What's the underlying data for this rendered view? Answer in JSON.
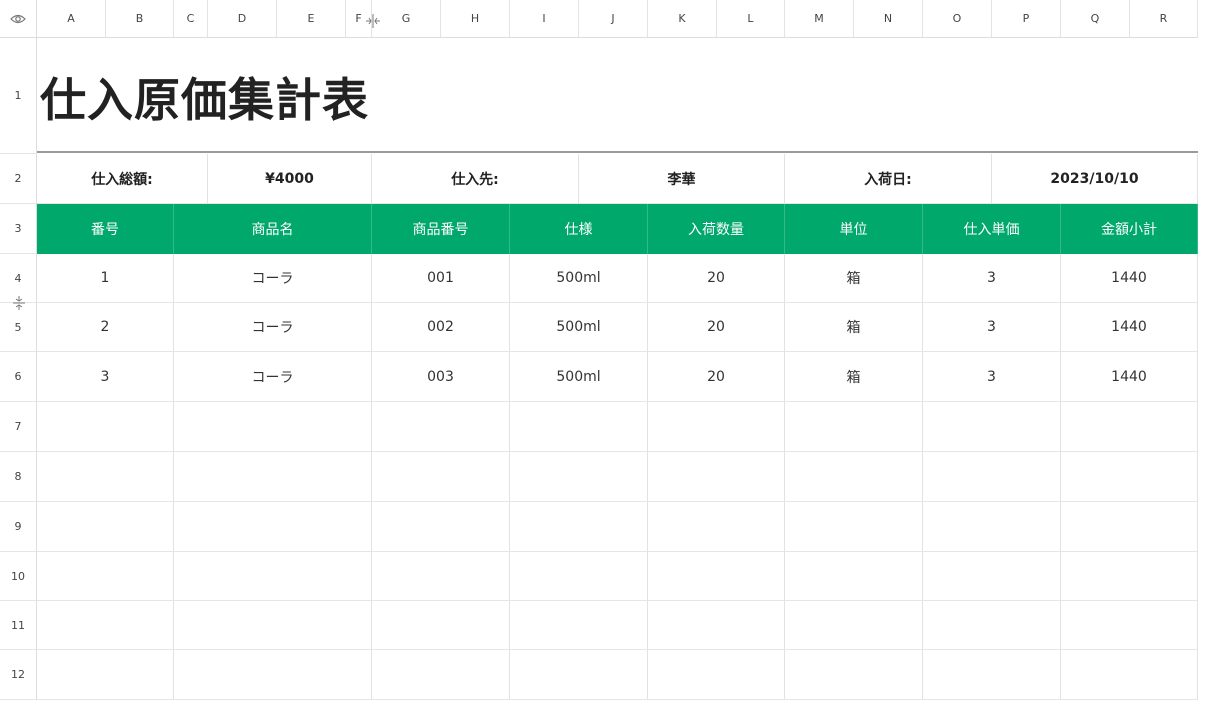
{
  "column_letters": [
    "A",
    "B",
    "C",
    "D",
    "E",
    "F",
    "G",
    "H",
    "I",
    "J",
    "K",
    "L",
    "M",
    "N",
    "O",
    "P",
    "Q",
    "R"
  ],
  "row_numbers": [
    "1",
    "2",
    "3",
    "4",
    "5",
    "6",
    "7",
    "8",
    "9",
    "10",
    "11",
    "12"
  ],
  "title": "仕入原価集計表",
  "info_row": {
    "total_label": "仕入総額:",
    "total_value": "¥4000",
    "supplier_label": "仕入先:",
    "supplier_value": "李華",
    "date_label": "入荷日:",
    "date_value": "2023/10/10"
  },
  "table": {
    "headers": [
      "番号",
      "商品名",
      "商品番号",
      "仕様",
      "入荷数量",
      "単位",
      "仕入単価",
      "金額小計"
    ],
    "rows": [
      [
        "1",
        "コーラ",
        "001",
        "500ml",
        "20",
        "箱",
        "3",
        "1440"
      ],
      [
        "2",
        "コーラ",
        "002",
        "500ml",
        "20",
        "箱",
        "3",
        "1440"
      ],
      [
        "3",
        "コーラ",
        "003",
        "500ml",
        "20",
        "箱",
        "3",
        "1440"
      ]
    ]
  },
  "colors": {
    "header_green": "#00a86b"
  },
  "icons": {
    "corner": "eye-icon"
  }
}
